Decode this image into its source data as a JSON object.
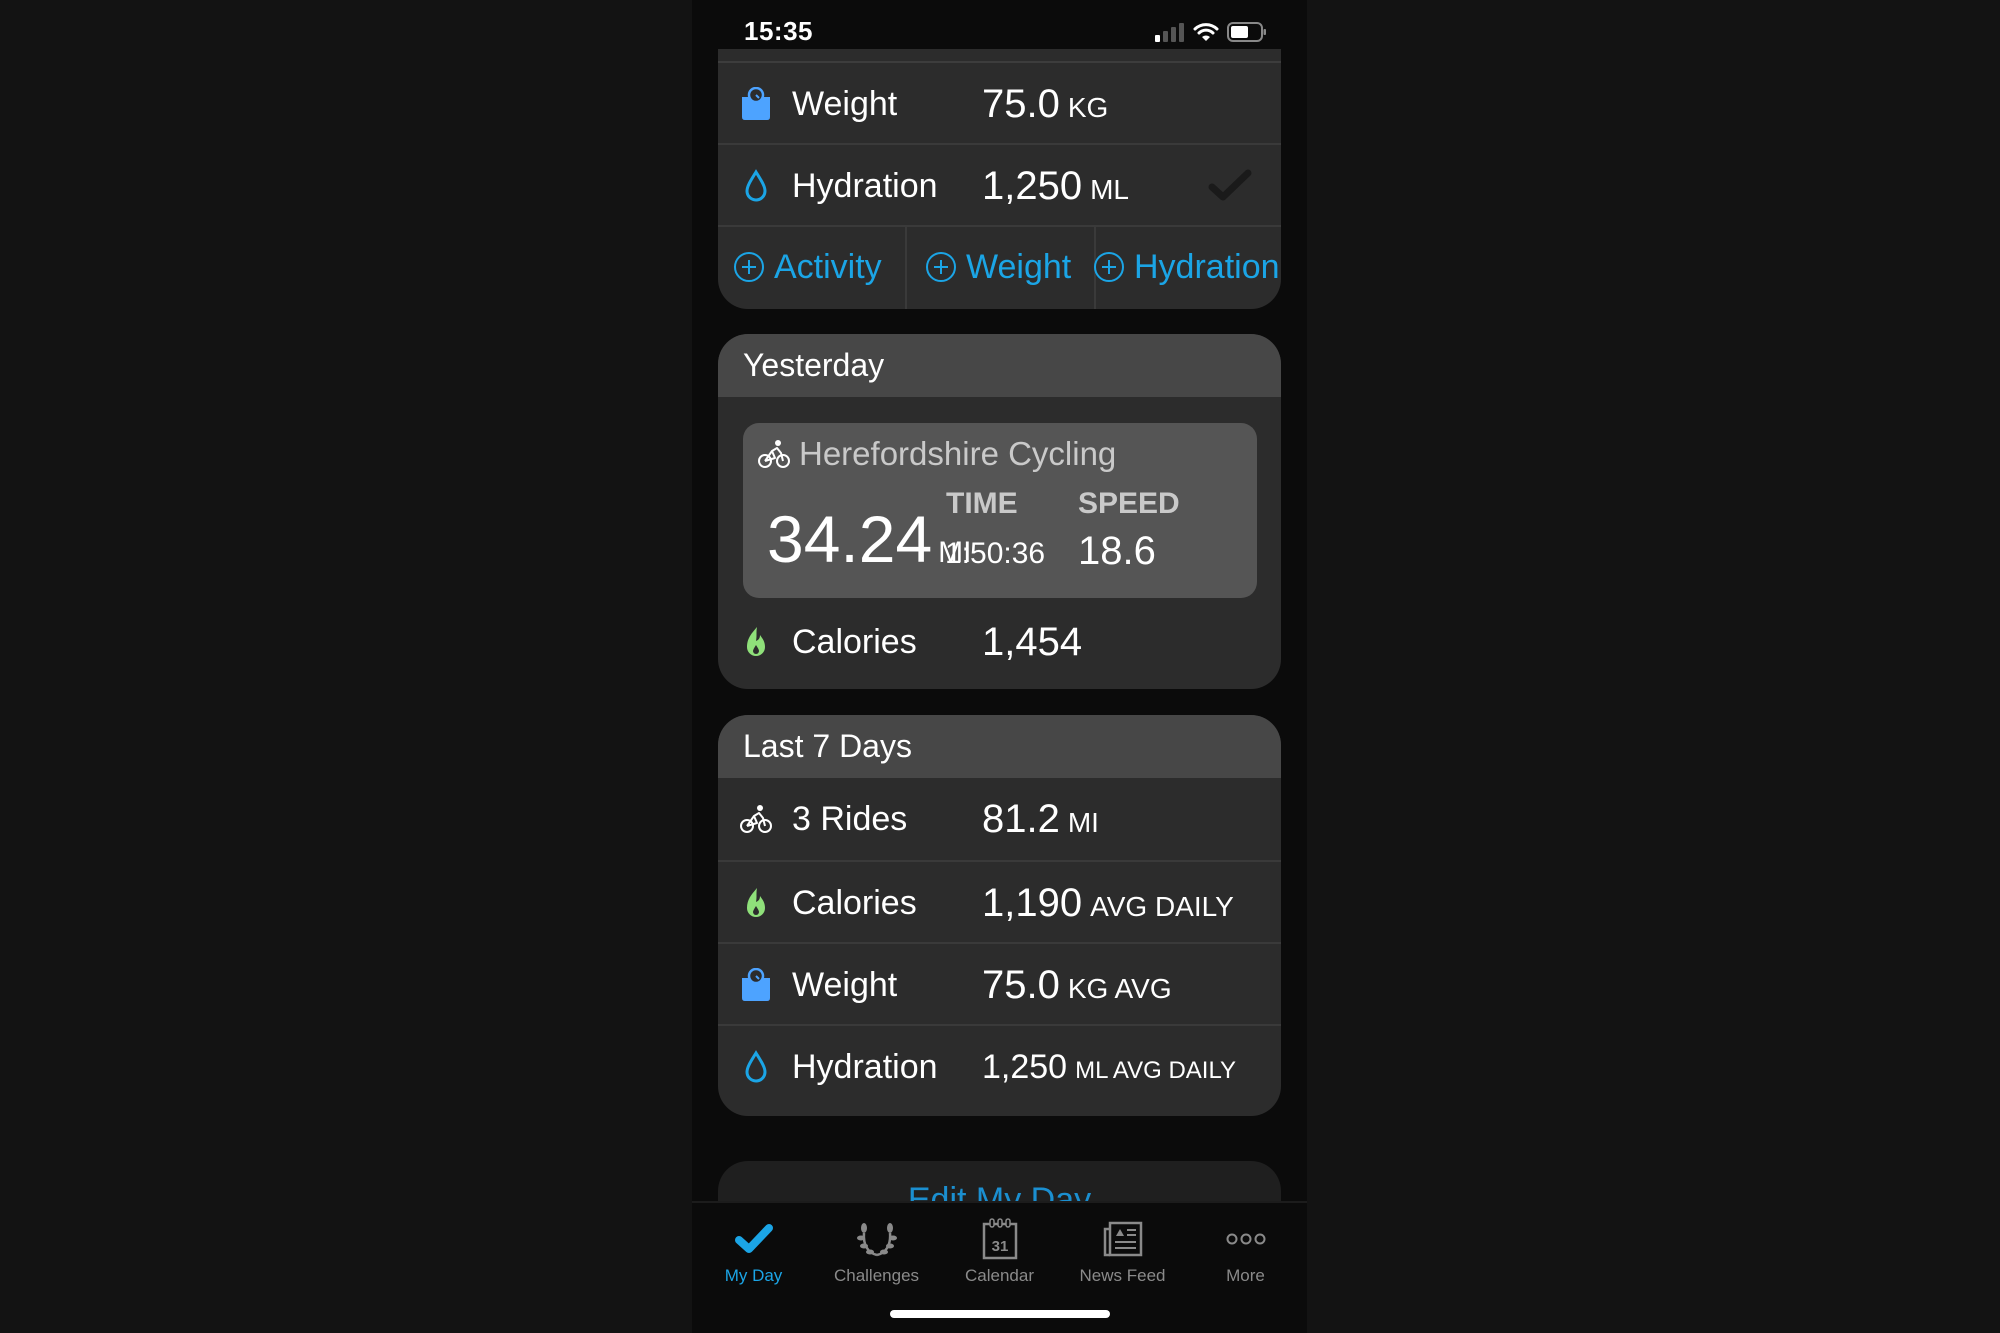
{
  "status_bar": {
    "time": "15:35",
    "icons": [
      "cellular-signal-icon",
      "wifi-icon",
      "battery-icon"
    ]
  },
  "colors": {
    "accent": "#1ba5e6",
    "weight": "#4da3ff",
    "calories": "#8fe07a",
    "hydration": "#1ba5e6"
  },
  "today": {
    "rows": [
      {
        "icon": "scale-icon",
        "label": "Weight",
        "value": "75.0",
        "unit": "KG"
      },
      {
        "icon": "water-drop-icon",
        "label": "Hydration",
        "value": "1,250",
        "unit": "ML",
        "status_icon": "checkmark-icon"
      }
    ],
    "actions": [
      {
        "icon": "plus-circle-icon",
        "label": "Activity"
      },
      {
        "icon": "plus-circle-icon",
        "label": "Weight"
      },
      {
        "icon": "plus-circle-icon",
        "label": "Hydration"
      }
    ]
  },
  "yesterday": {
    "title": "Yesterday",
    "activity": {
      "icon": "cycling-icon",
      "name": "Herefordshire Cycling",
      "distance": "34.24",
      "distance_unit": "MI",
      "time_label": "TIME",
      "time": "1:50:36",
      "speed_label": "SPEED",
      "speed": "18.6"
    },
    "calories": {
      "icon": "flame-icon",
      "label": "Calories",
      "value": "1,454"
    }
  },
  "last7": {
    "title": "Last 7 Days",
    "rows": [
      {
        "icon": "cycling-icon",
        "label": "3 Rides",
        "value": "81.2",
        "unit": "MI"
      },
      {
        "icon": "flame-icon",
        "label": "Calories",
        "value": "1,190",
        "unit": "AVG DAILY"
      },
      {
        "icon": "scale-icon",
        "label": "Weight",
        "value": "75.0",
        "unit": "KG AVG"
      },
      {
        "icon": "water-drop-icon",
        "label": "Hydration",
        "value": "1,250",
        "unit": "ML AVG DAILY"
      }
    ]
  },
  "edit_button": "Edit My Day",
  "tabs": [
    {
      "icon": "checkmark-icon",
      "label": "My Day",
      "active": true
    },
    {
      "icon": "laurel-icon",
      "label": "Challenges",
      "active": false
    },
    {
      "icon": "calendar-icon",
      "label": "Calendar",
      "active": false,
      "icon_text": "31"
    },
    {
      "icon": "newspaper-icon",
      "label": "News Feed",
      "active": false
    },
    {
      "icon": "more-icon",
      "label": "More",
      "active": false
    }
  ]
}
